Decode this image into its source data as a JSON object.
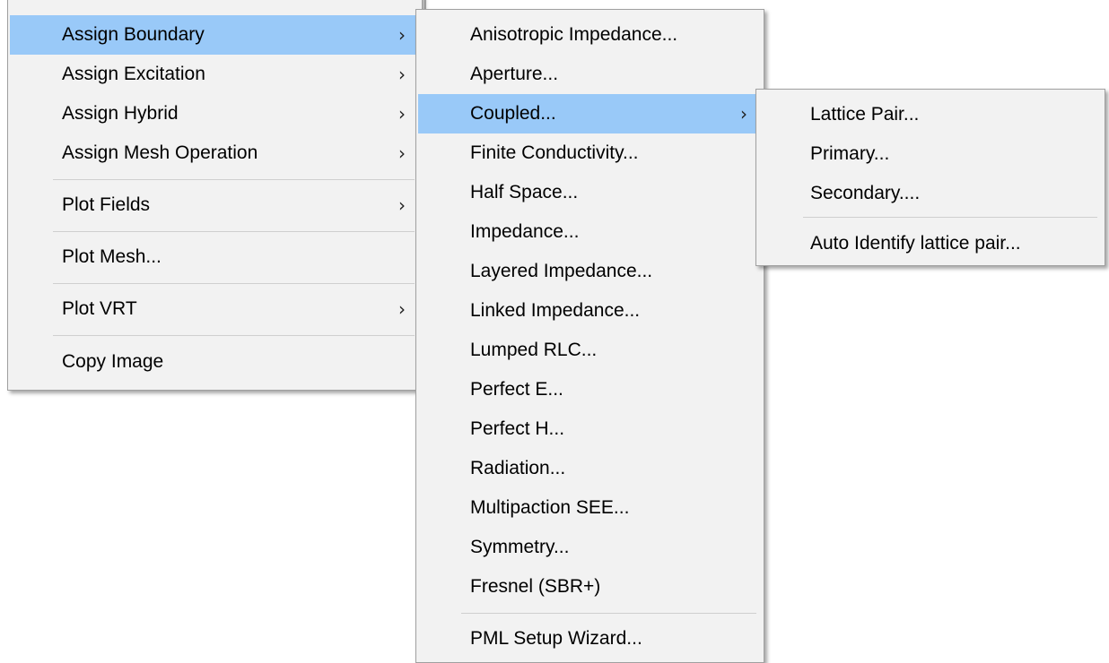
{
  "main_menu": {
    "items": [
      {
        "label": "Assign Boundary",
        "arrow": "›"
      },
      {
        "label": "Assign Excitation",
        "arrow": "›"
      },
      {
        "label": "Assign Hybrid",
        "arrow": "›"
      },
      {
        "label": "Assign Mesh Operation",
        "arrow": "›"
      },
      {
        "label": "Plot Fields",
        "arrow": "›"
      },
      {
        "label": "Plot Mesh..."
      },
      {
        "label": "Plot VRT",
        "arrow": "›"
      },
      {
        "label": "Copy Image"
      }
    ]
  },
  "boundary_menu": {
    "items": [
      {
        "label": "Anisotropic Impedance..."
      },
      {
        "label": "Aperture..."
      },
      {
        "label": "Coupled...",
        "arrow": "›"
      },
      {
        "label": "Finite Conductivity..."
      },
      {
        "label": "Half Space..."
      },
      {
        "label": "Impedance..."
      },
      {
        "label": "Layered Impedance..."
      },
      {
        "label": "Linked Impedance..."
      },
      {
        "label": "Lumped RLC..."
      },
      {
        "label": "Perfect E..."
      },
      {
        "label": "Perfect H..."
      },
      {
        "label": "Radiation..."
      },
      {
        "label": "Multipaction SEE..."
      },
      {
        "label": "Symmetry..."
      },
      {
        "label": "Fresnel (SBR+)"
      },
      {
        "label": "PML Setup Wizard..."
      }
    ]
  },
  "coupled_menu": {
    "items": [
      {
        "label": "Lattice Pair..."
      },
      {
        "label": "Primary..."
      },
      {
        "label": "Secondary...."
      },
      {
        "label": "Auto Identify lattice pair..."
      }
    ]
  },
  "colors": {
    "highlight": "#99c9f8",
    "menu_bg": "#f2f2f2",
    "separator": "#cfcfcf"
  }
}
